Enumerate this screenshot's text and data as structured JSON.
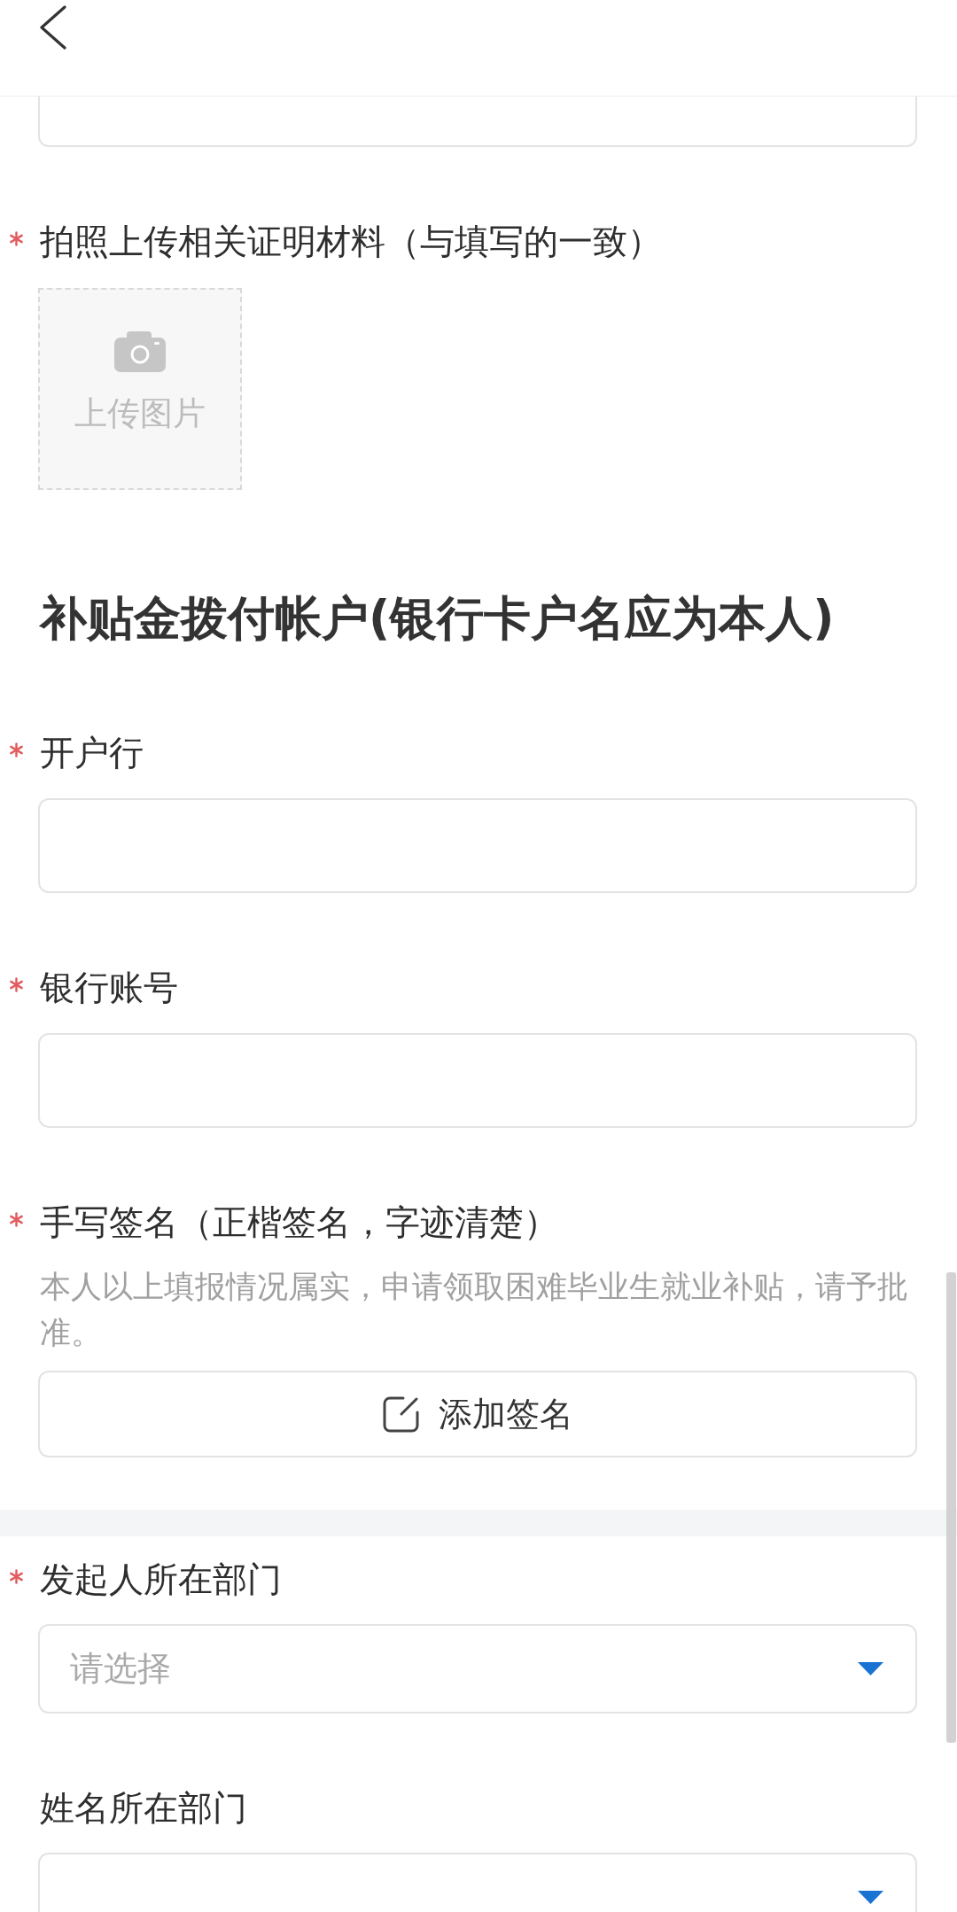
{
  "sections": [
    {
      "items": [
        {
          "kind": "input"
        },
        {
          "kind": "upload",
          "label": "拍照上传相关证明材料（与填写的一致）",
          "required": true,
          "button": "上传图片"
        },
        {
          "kind": "heading",
          "text": "补贴金拨付帐户(银行卡户名应为本人)"
        },
        {
          "kind": "input",
          "label": "开户行",
          "required": true
        },
        {
          "kind": "input",
          "label": "银行账号",
          "required": true
        },
        {
          "kind": "signature",
          "label": "手写签名（正楷签名，字迹清楚）",
          "required": true,
          "description": "本人以上填报情况属实，申请领取困难毕业生就业补贴，请予批准。",
          "button": "添加签名"
        }
      ]
    },
    {
      "items": [
        {
          "kind": "select",
          "label": "发起人所在部门",
          "required": true,
          "placeholder": "请选择"
        },
        {
          "kind": "select",
          "label": "姓名所在部门",
          "required": false
        }
      ]
    }
  ]
}
